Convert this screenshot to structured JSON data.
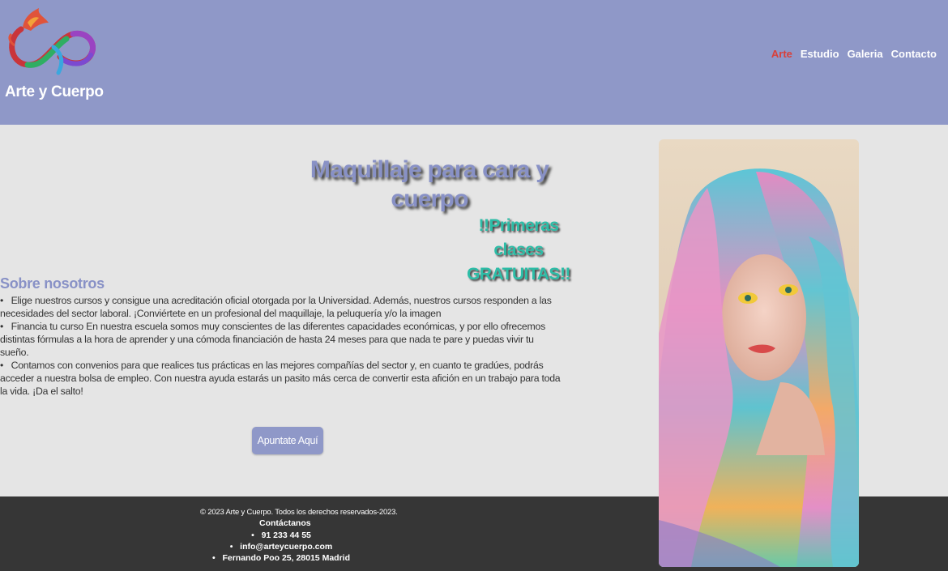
{
  "header": {
    "brand": "Arte y Cuerpo",
    "logo_icon": "infinity-phoenix-logo",
    "nav": [
      {
        "label": "Arte",
        "active": true
      },
      {
        "label": "Estudio",
        "active": false
      },
      {
        "label": "Galeria",
        "active": false
      },
      {
        "label": "Contacto",
        "active": false
      }
    ],
    "colors": {
      "header_bg": "#8f98c8",
      "active_link": "#d9403a"
    }
  },
  "main": {
    "hero_title": "Maquillaje para cara y cuerpo",
    "promo": "!!Primeras clases GRATUITAS!!",
    "about_title": "Sobre nosotros",
    "about_items": [
      "Elige nuestros cursos y consigue una acreditación oficial otorgada por la Universidad. Además, nuestros cursos responden a las necesidades del sector laboral. ¡Conviértete en un profesional del maquillaje, la peluquería y/o la imagen",
      "Financia tu curso En nuestra escuela somos muy conscientes de las diferentes capacidades económicas, y por ello ofrecemos distintas fórmulas a la hora de aprender y una cómoda financiación de hasta 24 meses para que nada te pare y puedas vivir tu sueño.",
      "Contamos con convenios para que realices tus prácticas en las mejores compañías del sector y, en cuanto te gradúes, podrás acceder a nuestra bolsa de empleo. Con nuestra ayuda estarás un pasito más cerca de convertir esta afición en un trabajo para toda la vida. ¡Da el salto!"
    ],
    "cta_label": "Apuntate Aquí",
    "photo_icon": "portrait-photo-rainbow-hair",
    "colors": {
      "accent": "#8891c6",
      "promo": "#2cbda7"
    }
  },
  "footer": {
    "copyright": "© 2023 Arte y Cuerpo. Todos los derechos reservados-2023.",
    "contact_title": "Contáctanos",
    "contacts": [
      "91 233 44 55",
      "info@arteycuerpo.com",
      "Fernando Poo 25, 28015 Madrid"
    ],
    "colors": {
      "footer_bg": "#363636"
    }
  }
}
